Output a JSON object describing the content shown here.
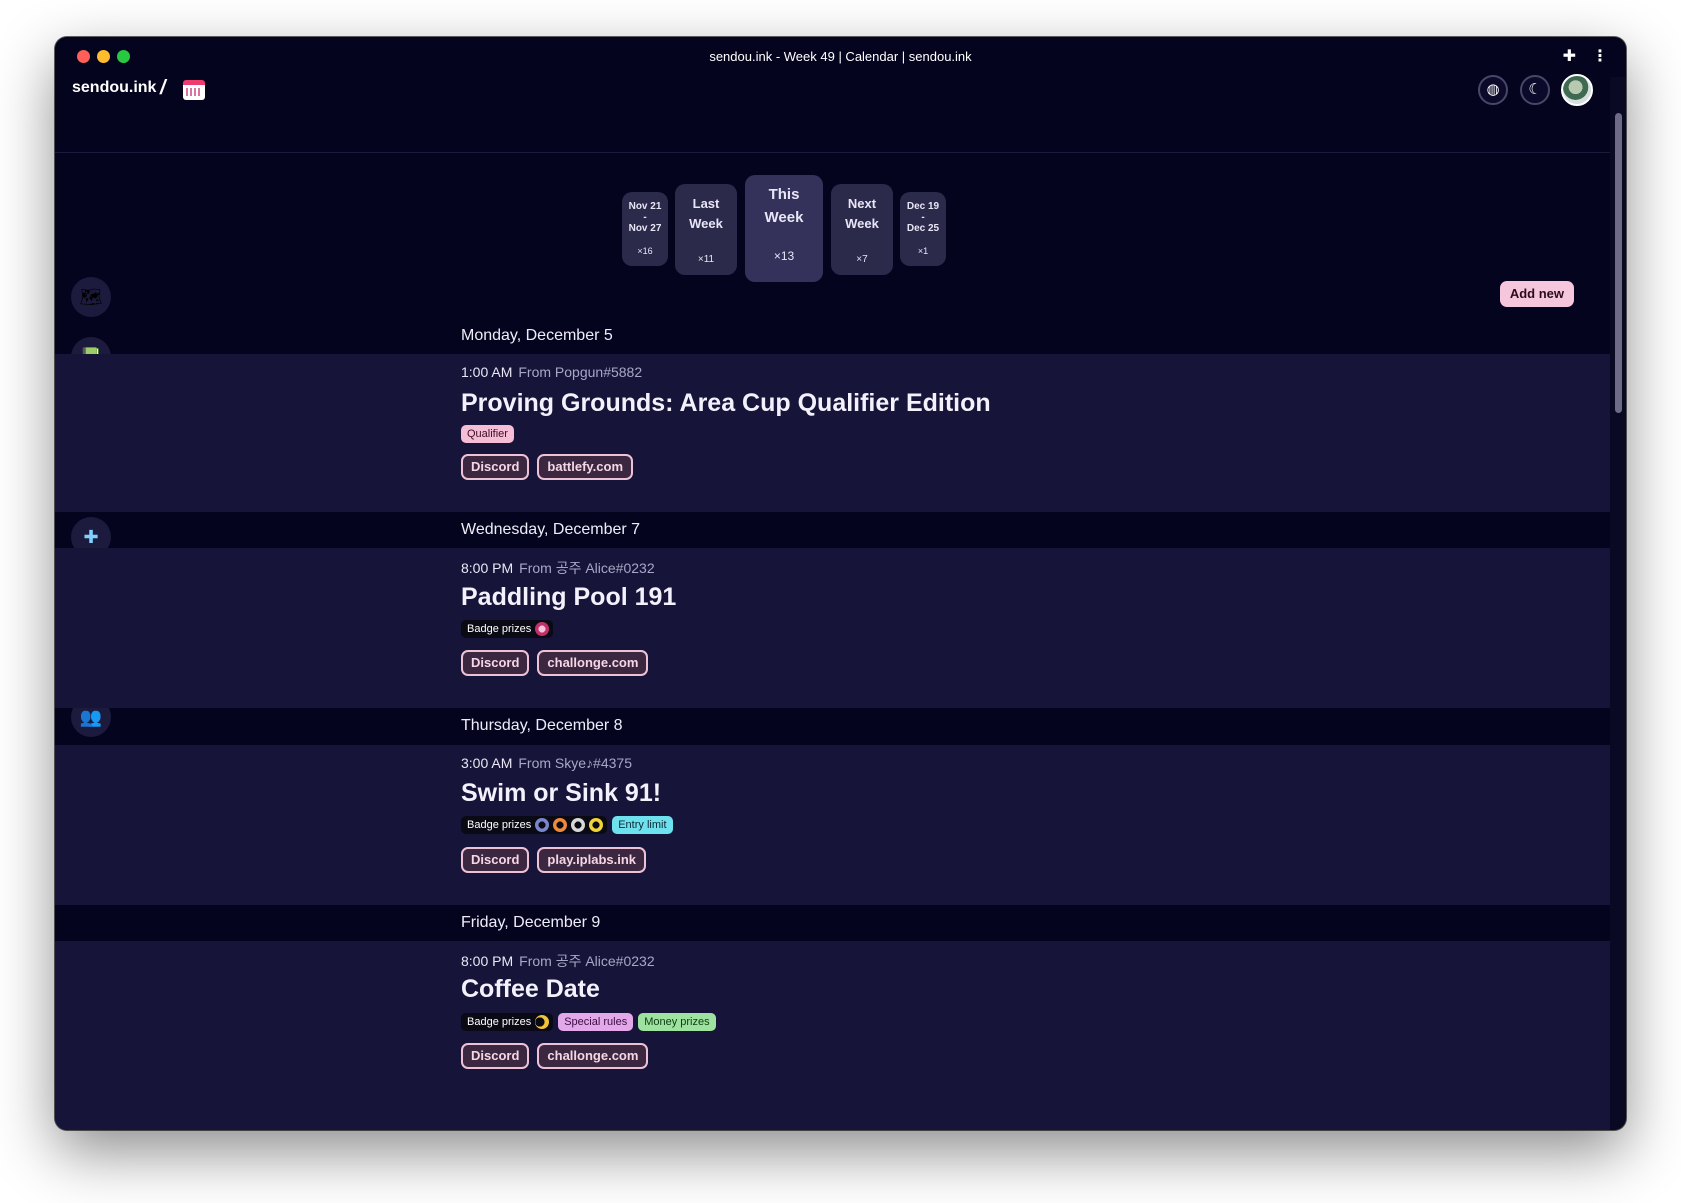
{
  "window": {
    "title": "sendou.ink - Week 49 | Calendar | sendou.ink"
  },
  "header": {
    "brand": "sendou.ink",
    "separator": "/",
    "page_icon": "calendar-icon",
    "buttons": [
      "globe-icon",
      "moon-icon",
      "avatar"
    ]
  },
  "weeks": [
    {
      "line1": "Nov 21",
      "dash": "-",
      "line2": "Nov 27",
      "count": "×16"
    },
    {
      "line1": "Last",
      "line2": "Week",
      "count": "×11"
    },
    {
      "line1": "This",
      "line2": "Week",
      "count": "×13"
    },
    {
      "line1": "Next",
      "line2": "Week",
      "count": "×7"
    },
    {
      "line1": "Dec 19",
      "dash": "-",
      "line2": "Dec 25",
      "count": "×1"
    }
  ],
  "add_new_label": "Add new",
  "nav_icons": [
    "map-icon",
    "builds-icon",
    "trophy-icon",
    "calendar-icon",
    "plus-icon",
    "artist-icon",
    "squid-icon",
    "team-icon",
    "octo-icon",
    "notes-icon"
  ],
  "days": [
    {
      "heading": "Monday, December 5",
      "event": {
        "time": "1:00 AM",
        "from": "From Popgun#5882",
        "title": "Proving Grounds: Area Cup Qualifier Edition",
        "tags": {
          "qualifier": "Qualifier"
        },
        "links": [
          "Discord",
          "battlefy.com"
        ]
      }
    },
    {
      "heading": "Wednesday, December 7",
      "event": {
        "time": "8:00 PM",
        "from": "From 공주 Alice#0232",
        "title": "Paddling Pool 191",
        "tags": {
          "badge": "Badge prizes"
        },
        "links": [
          "Discord",
          "challonge.com"
        ]
      }
    },
    {
      "heading": "Thursday, December 8",
      "event": {
        "time": "3:00 AM",
        "from": "From Skye♪#4375",
        "title": "Swim or Sink 91!",
        "tags": {
          "badge": "Badge prizes",
          "entry": "Entry limit"
        },
        "links": [
          "Discord",
          "play.iplabs.ink"
        ]
      }
    },
    {
      "heading": "Friday, December 9",
      "event": {
        "time": "8:00 PM",
        "from": "From 공주 Alice#0232",
        "title": "Coffee Date",
        "tags": {
          "badge": "Badge prizes",
          "special": "Special rules",
          "money": "Money prizes"
        },
        "links": [
          "Discord",
          "challonge.com"
        ]
      }
    }
  ],
  "colors": {
    "background": "#05041f",
    "card": "#161438",
    "accent_pink": "#f6c7dc",
    "entry_limit": "#6ee1ef",
    "special_rules": "#e2a8ea",
    "money_prizes": "#9ee2a0"
  }
}
